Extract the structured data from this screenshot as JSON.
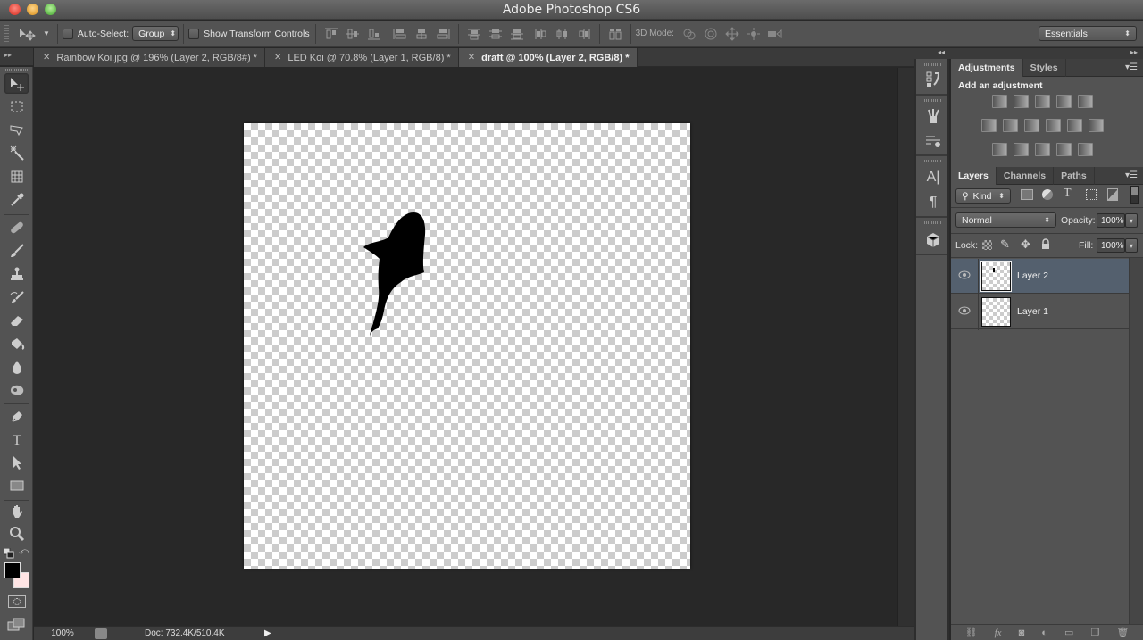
{
  "app": {
    "title": "Adobe Photoshop CS6"
  },
  "options_bar": {
    "auto_select_label": "Auto-Select:",
    "auto_select_checked": false,
    "auto_select_mode": "Group",
    "show_transform_label": "Show Transform Controls",
    "show_transform_checked": false,
    "mode_3d_label": "3D Mode:",
    "workspace": "Essentials"
  },
  "doc_tabs": [
    {
      "label": "Rainbow Koi.jpg @ 196% (Layer 2, RGB/8#) *",
      "active": false
    },
    {
      "label": "LED Koi @ 70.8% (Layer 1, RGB/8) *",
      "active": false
    },
    {
      "label": "draft @ 100% (Layer 2, RGB/8) *",
      "active": true
    }
  ],
  "tools": [
    {
      "name": "move-tool",
      "selected": true
    },
    {
      "name": "marquee-tool"
    },
    {
      "name": "lasso-tool"
    },
    {
      "name": "magic-wand-tool"
    },
    {
      "name": "crop-tool"
    },
    {
      "name": "eyedropper-tool"
    },
    {
      "name": "healing-brush-tool"
    },
    {
      "name": "brush-tool"
    },
    {
      "name": "clone-stamp-tool"
    },
    {
      "name": "history-brush-tool"
    },
    {
      "name": "eraser-tool"
    },
    {
      "name": "paint-bucket-tool"
    },
    {
      "name": "blur-tool"
    },
    {
      "name": "dodge-tool"
    },
    {
      "name": "pen-tool"
    },
    {
      "name": "type-tool"
    },
    {
      "name": "path-selection-tool"
    },
    {
      "name": "rectangle-tool"
    },
    {
      "name": "hand-tool"
    },
    {
      "name": "zoom-tool"
    }
  ],
  "colors": {
    "foreground": "#000000",
    "background": "#ffe5e5",
    "selected_layer": "#54606e"
  },
  "status": {
    "zoom": "100%",
    "doc_size": "Doc: 732.4K/510.4K"
  },
  "adjustments_panel": {
    "tabs": [
      "Adjustments",
      "Styles"
    ],
    "active_tab": "Adjustments",
    "heading": "Add an adjustment",
    "rows": [
      [
        "brightness-contrast",
        "levels",
        "curves",
        "exposure",
        "vibrance"
      ],
      [
        "hue-saturation",
        "color-balance",
        "black-white",
        "photo-filter",
        "channel-mixer",
        "color-lookup"
      ],
      [
        "invert",
        "posterize",
        "threshold",
        "selective-color",
        "gradient-map"
      ]
    ]
  },
  "layers_panel": {
    "tabs": [
      "Layers",
      "Channels",
      "Paths"
    ],
    "active_tab": "Layers",
    "filter_kind": "Kind",
    "blend_mode": "Normal",
    "opacity_label": "Opacity:",
    "opacity": "100%",
    "lock_label": "Lock:",
    "fill_label": "Fill:",
    "fill": "100%",
    "layers": [
      {
        "name": "Layer 2",
        "visible": true,
        "selected": true
      },
      {
        "name": "Layer 1",
        "visible": true,
        "selected": false
      }
    ]
  }
}
